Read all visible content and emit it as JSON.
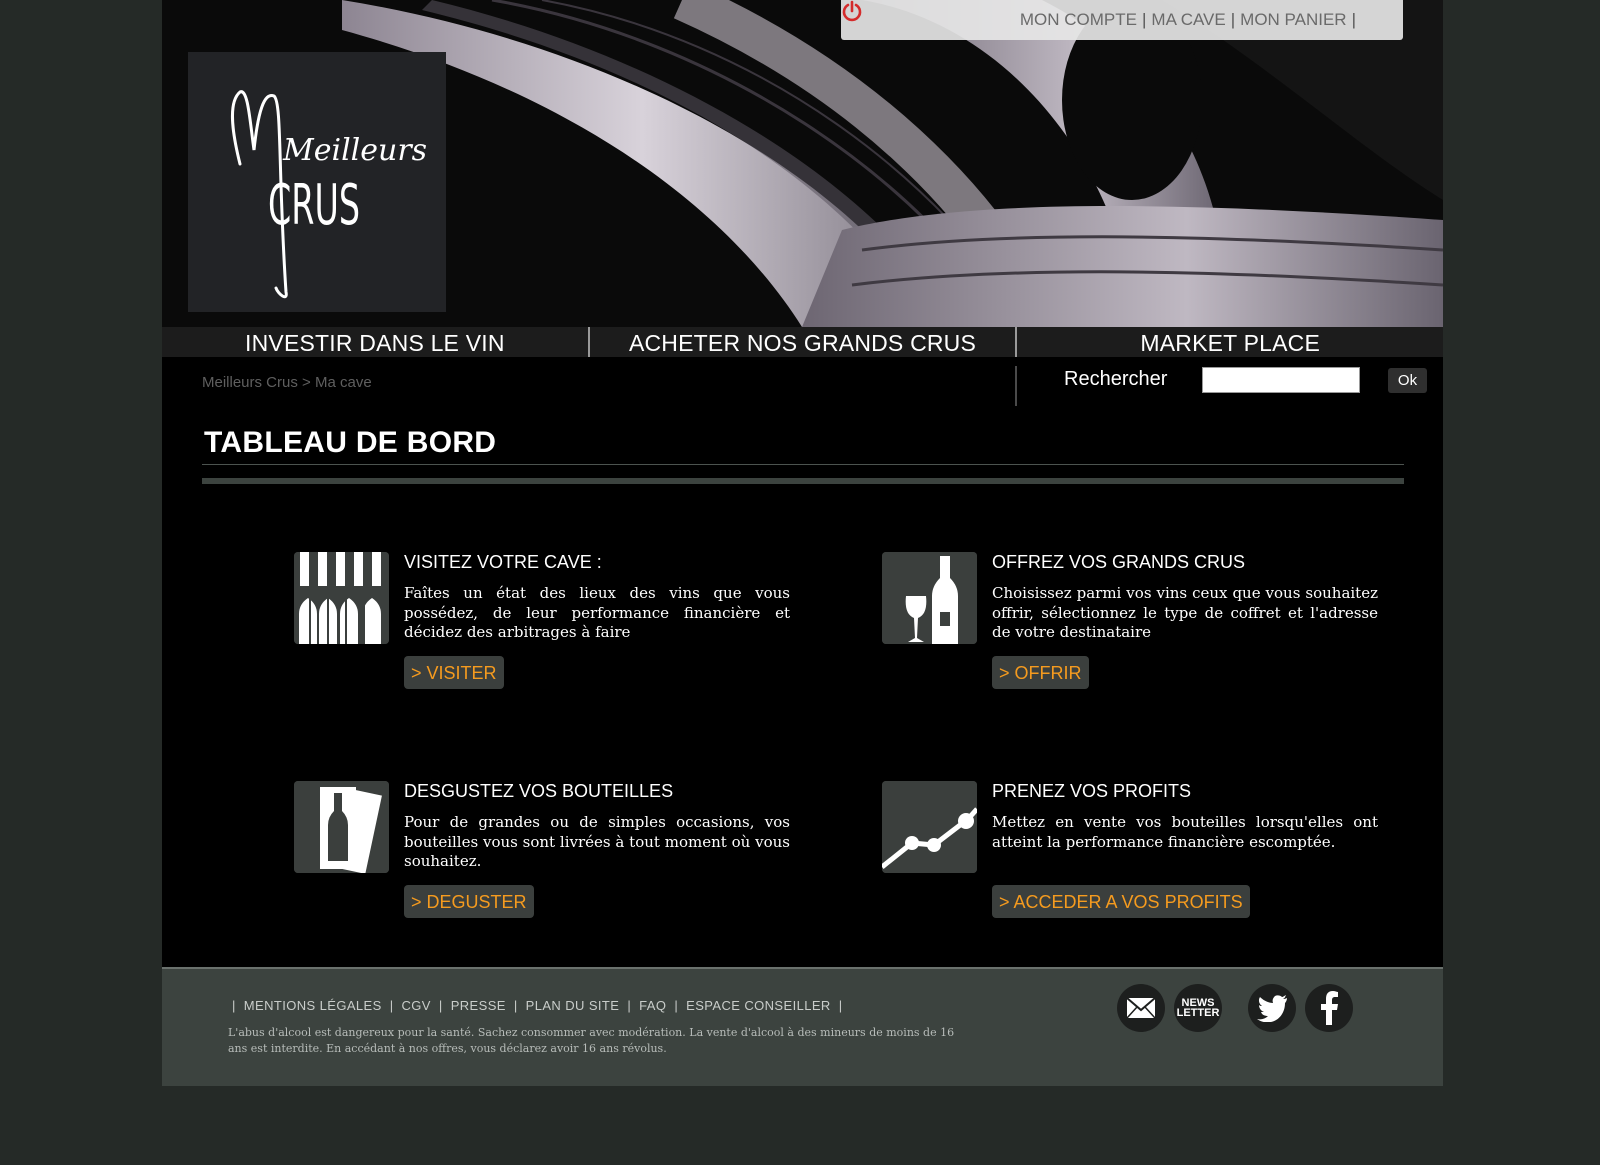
{
  "topbar": {
    "mon_compte": "MON COMPTE",
    "ma_cave": "MA CAVE",
    "mon_panier": "MON PANIER",
    "separator": "|"
  },
  "logo": {
    "line1": "Meilleurs",
    "line2": "CRUS"
  },
  "nav": [
    {
      "label": "INVESTIR DANS LE VIN"
    },
    {
      "label": "ACHETER NOS GRANDS CRUS"
    },
    {
      "label": "MARKET PLACE"
    }
  ],
  "breadcrumb": {
    "home": "Meilleurs Crus",
    "separator": ">",
    "current": "Ma cave"
  },
  "search": {
    "label": "Rechercher",
    "value": "",
    "button": "Ok"
  },
  "title": "TABLEAU DE BORD",
  "cards": [
    {
      "title": "VISITEZ VOTRE CAVE :",
      "description": "Faîtes un état des lieux des vins que vous possédez, de leur performance financière et décidez des arbitrages à faire",
      "button": "> VISITER",
      "icon": "wine-cellar-icon"
    },
    {
      "title": "OFFREZ VOS GRANDS CRUS",
      "description": "Choisissez parmi vos vins ceux que vous souhaitez offrir, sélectionnez le type de coffret et l'adresse de votre destinataire",
      "button": "> OFFRIR",
      "icon": "bottle-glass-icon"
    },
    {
      "title": "DESGUSTEZ VOS BOUTEILLES",
      "description": "Pour de grandes ou de simples occasions, vos bouteilles vous sont livrées à tout moment où vous souhaitez.",
      "button": "> DEGUSTER",
      "icon": "bottle-card-icon"
    },
    {
      "title": "PRENEZ VOS PROFITS",
      "description": "Mettez en vente vos bouteilles lorsqu'elles ont atteint la performance financière escomptée.",
      "button": "> ACCEDER A VOS PROFITS",
      "icon": "profit-chart-icon"
    }
  ],
  "footer": {
    "links": [
      "MENTIONS LÉGALES",
      "CGV",
      "PRESSE",
      "PLAN DU SITE",
      "FAQ",
      "ESPACE CONSEILLER"
    ],
    "disclaimer": "L'abus d'alcool est dangereux pour la santé. Sachez consommer avec modération. La vente d'alcool à des mineurs de moins de 16 ans est interdite. En accédant à nos offres, vous déclarez avoir 16 ans révolus.",
    "newsletter": [
      "NEWS",
      "LETTER"
    ]
  },
  "colors": {
    "accent": "#f59b1f",
    "button_bg": "#3b3f3d",
    "footer_bg": "#3c433f",
    "outer_bg": "#252a27",
    "power_icon": "#d42b2b"
  }
}
